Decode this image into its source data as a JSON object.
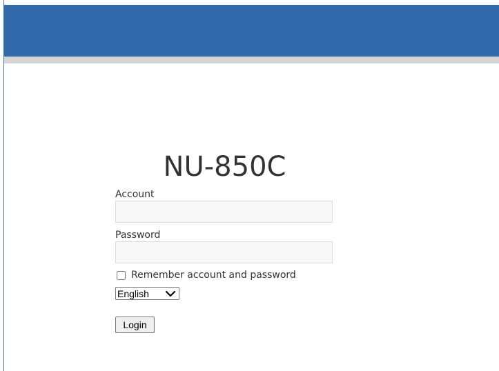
{
  "header": {
    "background_color": "#336aab",
    "separator_color": "#d4d4d4"
  },
  "login": {
    "product_name": "NU-850C",
    "account_label": "Account",
    "account_value": "",
    "password_label": "Password",
    "password_value": "",
    "remember_label": "Remember account and password",
    "remember_checked": false,
    "language_selected": "English",
    "language_icon": "chevron-down-icon",
    "login_button": "Login"
  }
}
